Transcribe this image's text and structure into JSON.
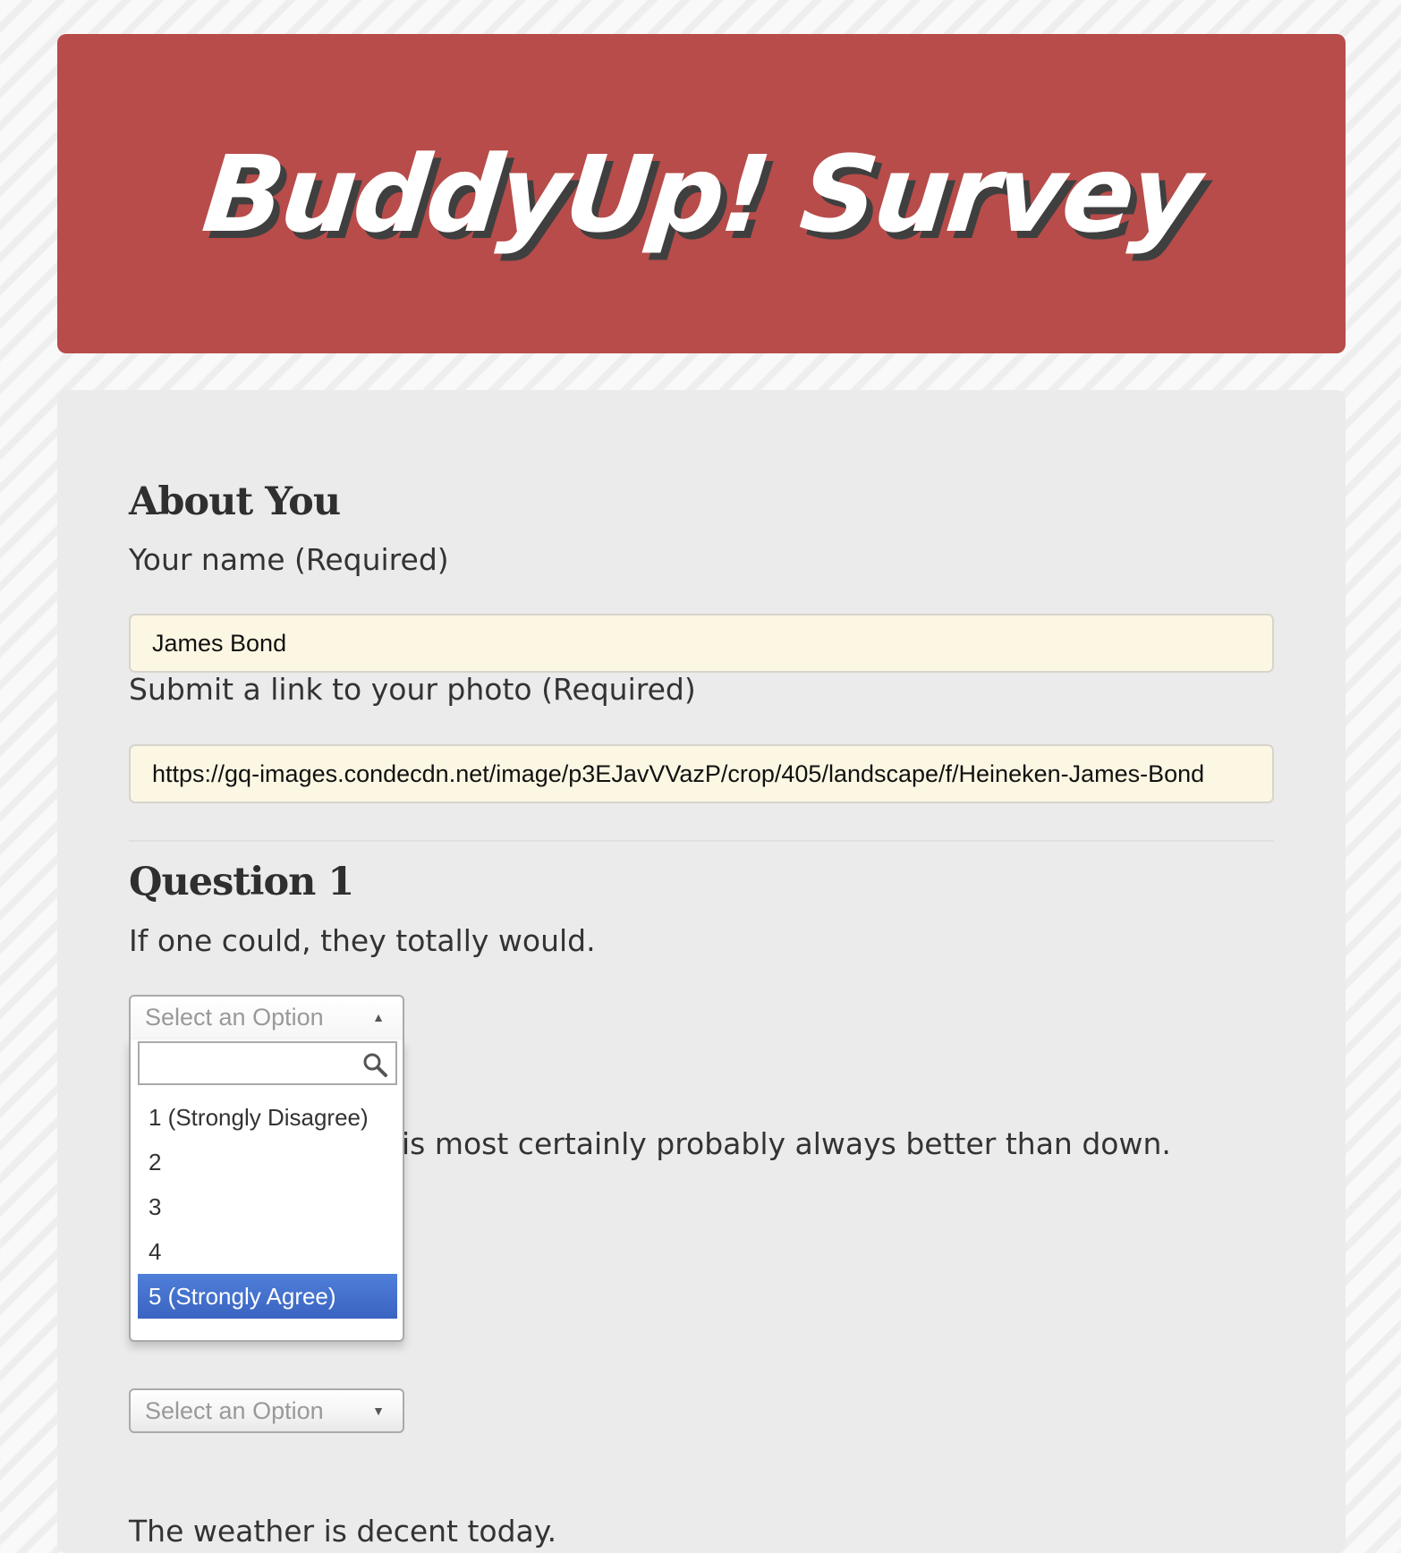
{
  "header": {
    "title": "BuddyUp! Survey"
  },
  "about": {
    "heading": "About You",
    "name_label": "Your name (Required)",
    "name_value": "James Bond",
    "photo_label": "Submit a link to your photo (Required)",
    "photo_value": "https://gq-images.condecdn.net/image/p3EJavVVazP/crop/405/landscape/f/Heineken-James-Bond"
  },
  "question1": {
    "heading": "Question 1",
    "prompt": "If one could, they totally would.",
    "select_placeholder": "Select an Option",
    "search_value": "",
    "options": [
      "1 (Strongly Disagree)",
      "2",
      "3",
      "4",
      "5 (Strongly Agree)"
    ],
    "highlighted_option": "5 (Strongly Agree)"
  },
  "question2": {
    "prompt_visible_fragment": "is most certainly probably always better than down."
  },
  "question3": {
    "prompt": "The weather is decent today.",
    "select_placeholder": "Select an Option"
  },
  "colors": {
    "header_bg": "#b74c4a",
    "title_shadow": "#3f3f3f",
    "panel_bg": "#ebebeb",
    "input_bg": "#fcf7e3",
    "highlight_bg": "#3f6bc8"
  },
  "icons": {
    "open_select_arrow": "triangle-up",
    "closed_select_arrow": "triangle-down",
    "search": "magnifier"
  }
}
